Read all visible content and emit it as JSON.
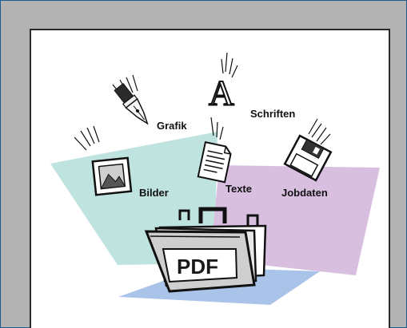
{
  "labels": {
    "grafik": "Grafik",
    "schriften": "Schriften",
    "bilder": "Bilder",
    "texte": "Texte",
    "jobdaten": "Jobdaten",
    "pdf": "PDF",
    "font_glyph": "A"
  },
  "colors": {
    "frame": "#b3b3b3",
    "border": "#1c5c8c",
    "teal_panel": "#bfe3df",
    "lilac_panel": "#d8bfe0",
    "blue_panel": "#a9c4e8"
  },
  "icons": [
    "pen-nib-icon",
    "font-icon",
    "picture-icon",
    "document-icon",
    "floppy-disk-icon",
    "briefcase-icon"
  ]
}
